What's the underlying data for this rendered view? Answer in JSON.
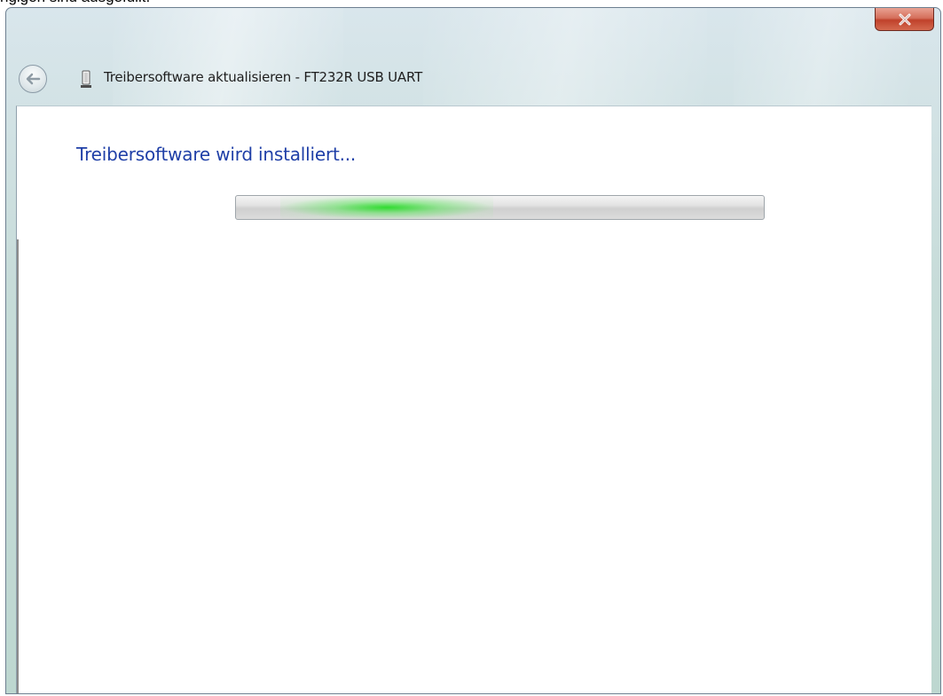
{
  "window": {
    "title": "Treibersoftware aktualisieren - FT232R USB UART",
    "heading": "Treibersoftware wird installiert...",
    "close_label": "X"
  },
  "progress": {
    "state": "indeterminate",
    "accent_color": "#22d422"
  },
  "icons": {
    "back": "back-arrow-icon",
    "device": "usb-device-icon",
    "close": "close-icon"
  },
  "colors": {
    "heading": "#1f3fa7",
    "close_button": "#c8452f",
    "title_bar": "#c7dcd9"
  }
}
